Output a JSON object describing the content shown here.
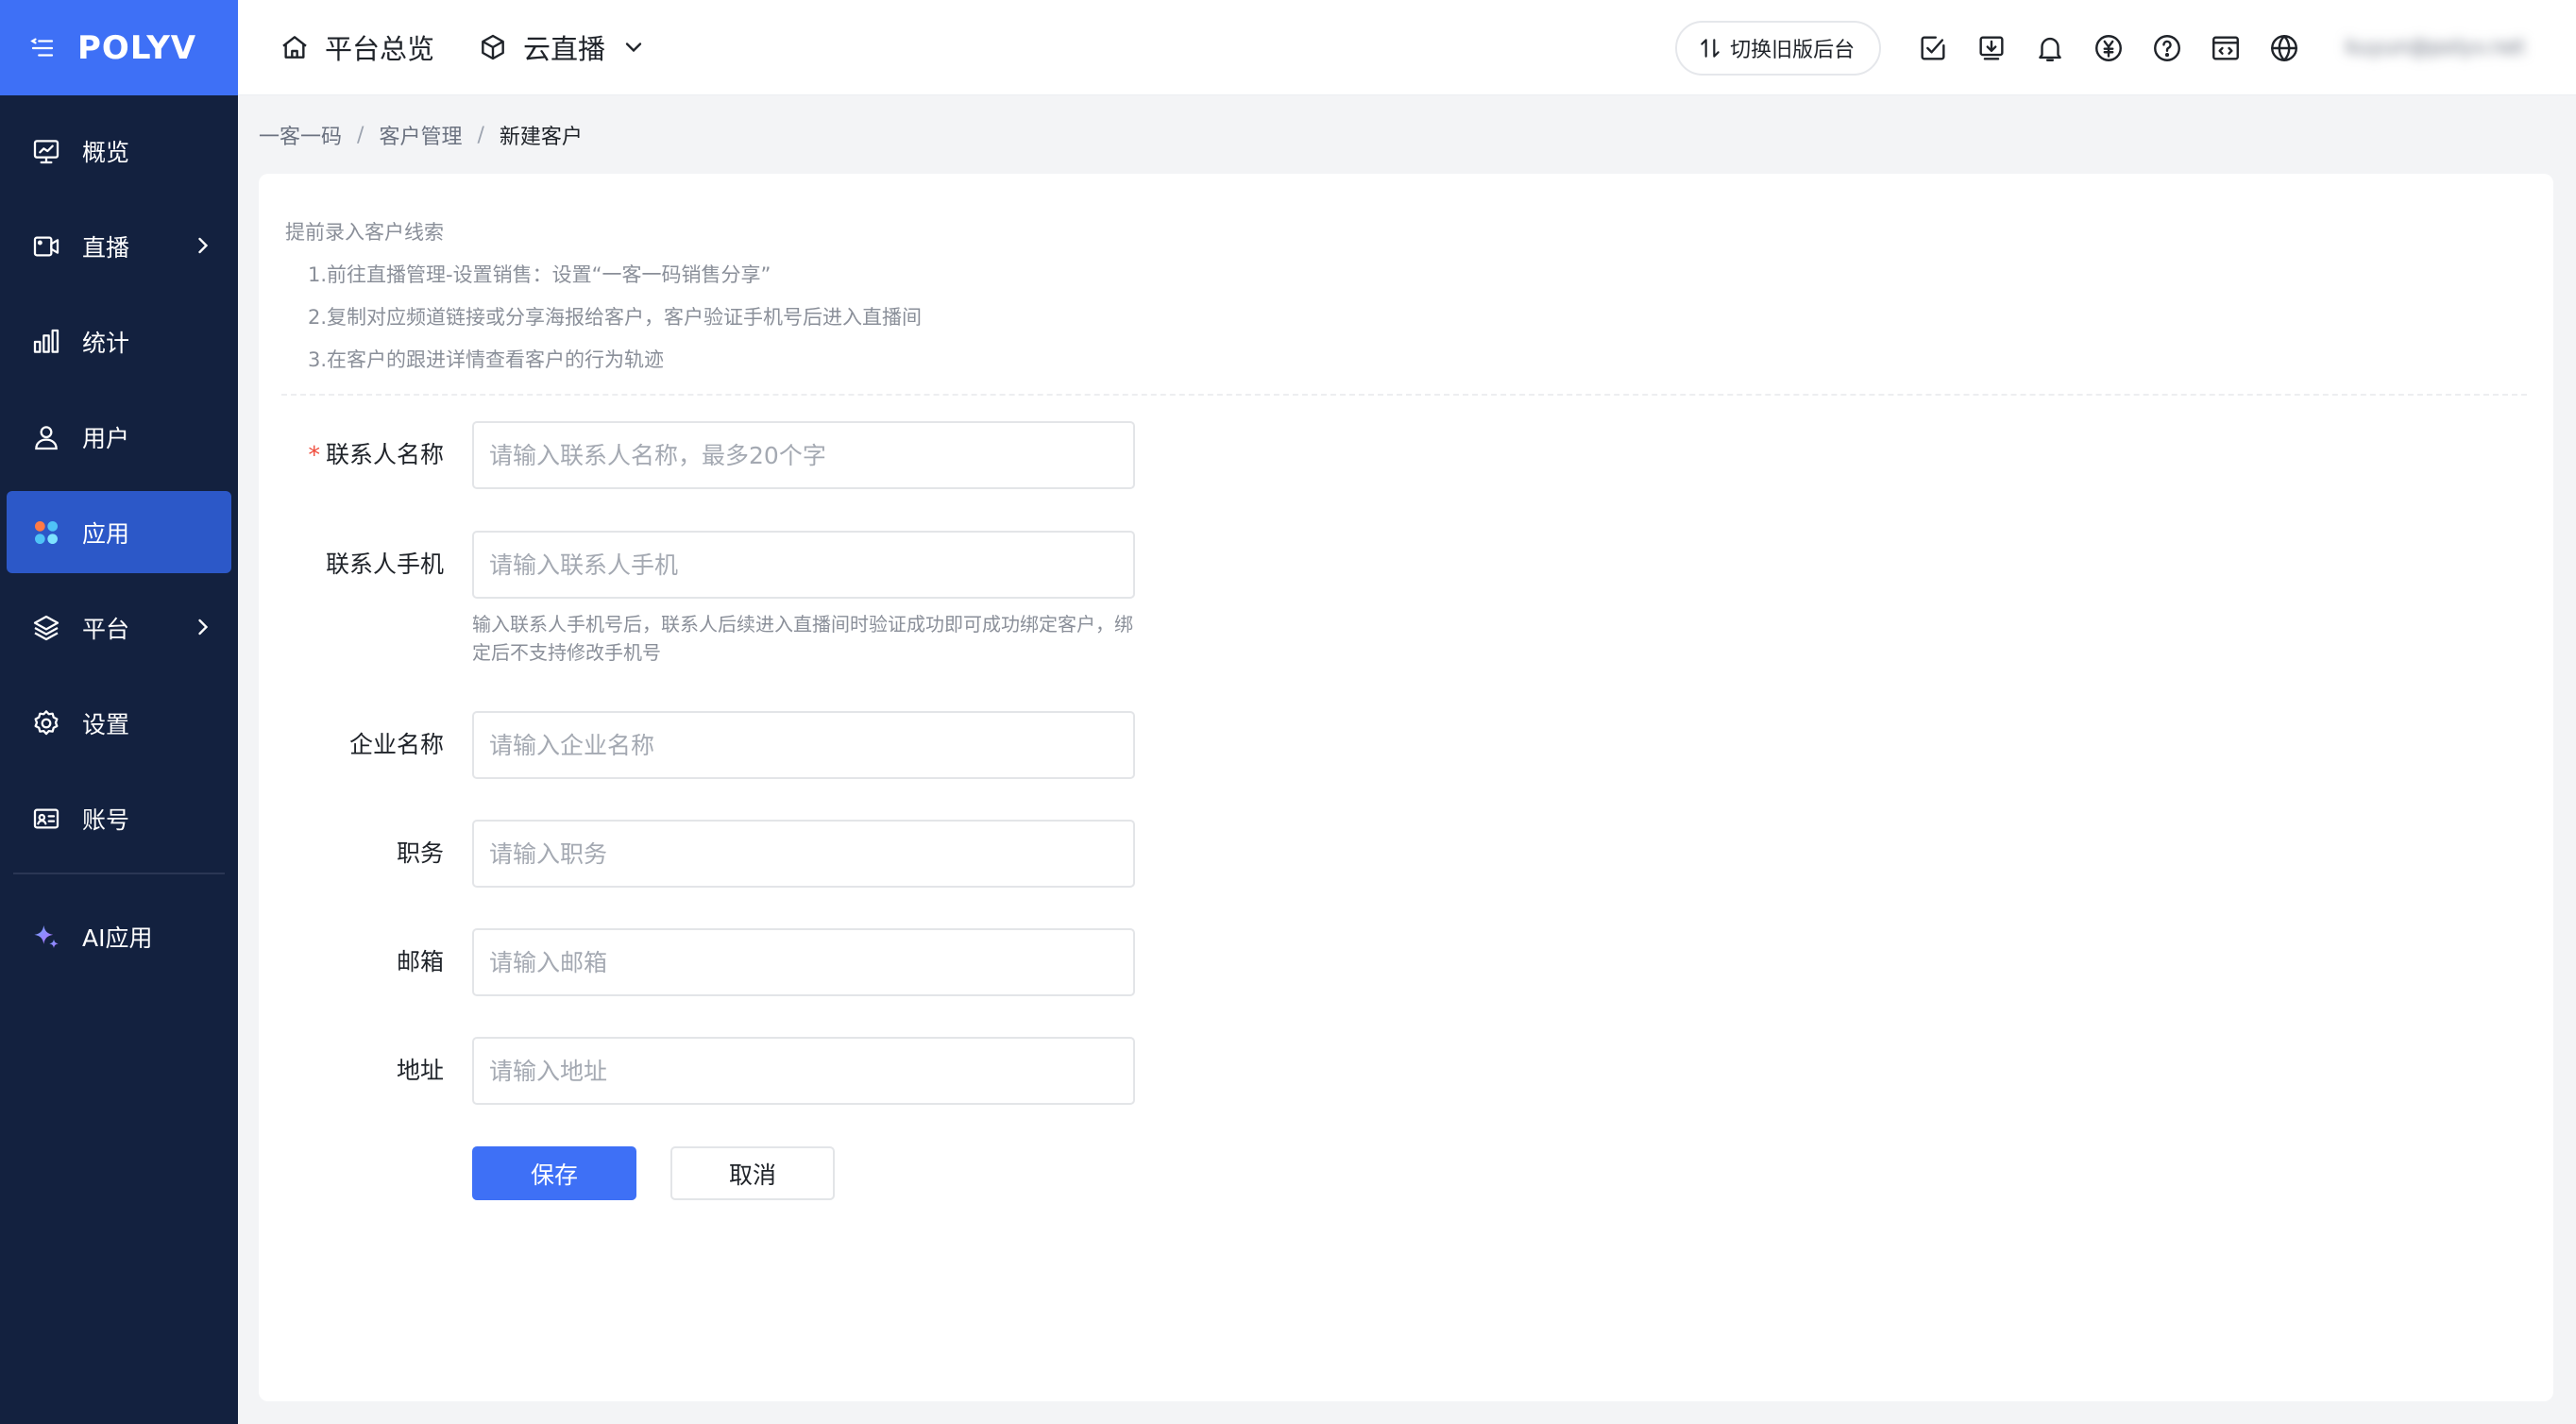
{
  "app": {
    "logo": "POLYV"
  },
  "sidebar": {
    "items": [
      {
        "label": "概览",
        "icon": "monitor-icon"
      },
      {
        "label": "直播",
        "icon": "video-camera-icon",
        "has_submenu": true
      },
      {
        "label": "统计",
        "icon": "bar-chart-icon"
      },
      {
        "label": "用户",
        "icon": "user-icon"
      },
      {
        "label": "应用",
        "icon": "apps-icon",
        "active": true
      },
      {
        "label": "平台",
        "icon": "layers-icon",
        "has_submenu": true
      },
      {
        "label": "设置",
        "icon": "gear-icon"
      },
      {
        "label": "账号",
        "icon": "id-card-icon"
      }
    ],
    "ai_item": {
      "label": "AI应用",
      "icon": "sparkle-icon"
    }
  },
  "topbar": {
    "home_label": "平台总览",
    "product_label": "云直播",
    "switch_label": "切换旧版后台",
    "user_label": "kuyun@polyv.net"
  },
  "breadcrumb": {
    "items": [
      "一客一码",
      "客户管理",
      "新建客户"
    ],
    "separator": "/"
  },
  "tips": {
    "title": "提前录入客户线索",
    "lines": [
      "1.前往直播管理-设置销售：设置“一客一码销售分享”",
      "2.复制对应频道链接或分享海报给客户，客户验证手机号后进入直播间",
      "3.在客户的跟进详情查看客户的行为轨迹"
    ]
  },
  "form": {
    "required_mark": "*",
    "contact_name": {
      "label": "联系人名称",
      "placeholder": "请输入联系人名称，最多20个字",
      "value": ""
    },
    "contact_phone": {
      "label": "联系人手机",
      "placeholder": "请输入联系人手机",
      "value": "",
      "hint": "输入联系人手机号后，联系人后续进入直播间时验证成功即可成功绑定客户，绑定后不支持修改手机号"
    },
    "company": {
      "label": "企业名称",
      "placeholder": "请输入企业名称",
      "value": ""
    },
    "position": {
      "label": "职务",
      "placeholder": "请输入职务",
      "value": ""
    },
    "email": {
      "label": "邮箱",
      "placeholder": "请输入邮箱",
      "value": ""
    },
    "address": {
      "label": "地址",
      "placeholder": "请输入地址",
      "value": ""
    },
    "save_label": "保存",
    "cancel_label": "取消"
  },
  "colors": {
    "primary": "#3e70f6",
    "sidebar_bg": "#13213f",
    "sidebar_active": "#2c58c8",
    "required": "#f04a3a"
  }
}
